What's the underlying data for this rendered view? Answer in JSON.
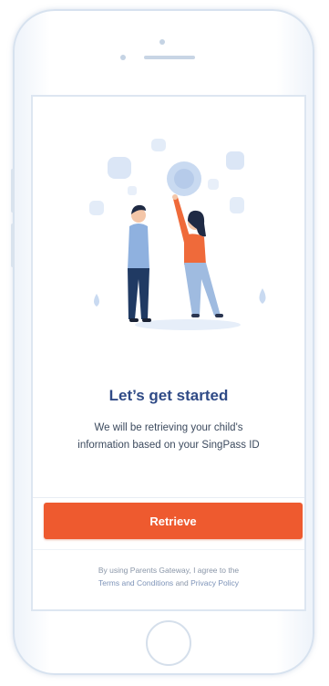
{
  "onboarding": {
    "title": "Let’s get started",
    "description_line1": "We will be retrieving your child's",
    "description_line2": "information based on your SingPass ID",
    "retrieve_label": "Retrieve",
    "consent_prefix": "By using Parents Gateway, I agree to the",
    "terms_label": "Terms and Conditions",
    "consent_and": "and",
    "privacy_label": "Privacy Policy"
  },
  "colors": {
    "title": "#2f4a86",
    "primary_button": "#ee5a2f",
    "woman_top": "#ef6a3a",
    "woman_pants": "#9fbbe0",
    "man_top": "#8fb1df",
    "man_pants": "#203a63",
    "bubbles": "#dbe6f6"
  },
  "icons": {
    "illustration": "people-reaching-floating-bubbles-illustration"
  }
}
